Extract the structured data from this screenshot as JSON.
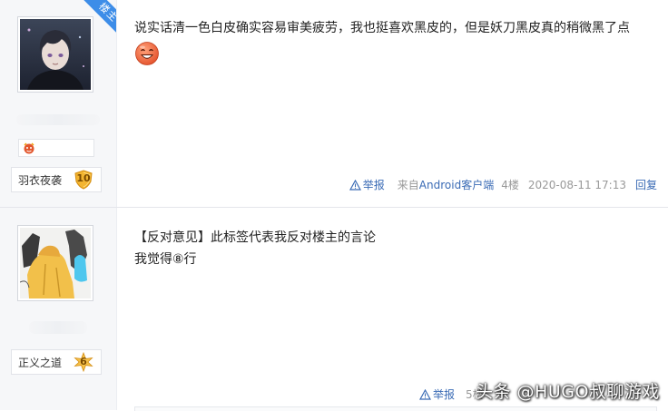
{
  "posts": [
    {
      "owner_badge": "楼主",
      "user_title": "羽衣夜袭",
      "level": "10",
      "content_lines": [
        "说实话清一色白皮确实容易审美疲劳，我也挺喜欢黑皮的，但是妖刀黑皮真的稍微黑了点"
      ],
      "footer": {
        "report": "举报",
        "source_prefix": "来自",
        "source_client": "Android客户端",
        "floor": "4楼",
        "time": "2020-08-11 17:13",
        "reply": "回复"
      }
    },
    {
      "user_title": "正义之道",
      "level": "6",
      "content_lines": [
        "【反对意见】此标签代表我反对楼主的言论",
        "我觉得⑧行"
      ],
      "footer": {
        "report": "举报",
        "floor_partial": "5楼"
      }
    }
  ],
  "watermark": "头条 @HUGO叔聊游戏",
  "colors": {
    "link": "#3a6bb5",
    "sidebar_bg": "#f6f7f9",
    "owner_badge": "#3d8de8",
    "level_badge": "#f3b531"
  },
  "icons": [
    "report-warning-icon",
    "laughing-emoji-icon",
    "small-emoji-icon",
    "level-shield-icon",
    "level-star-icon"
  ]
}
